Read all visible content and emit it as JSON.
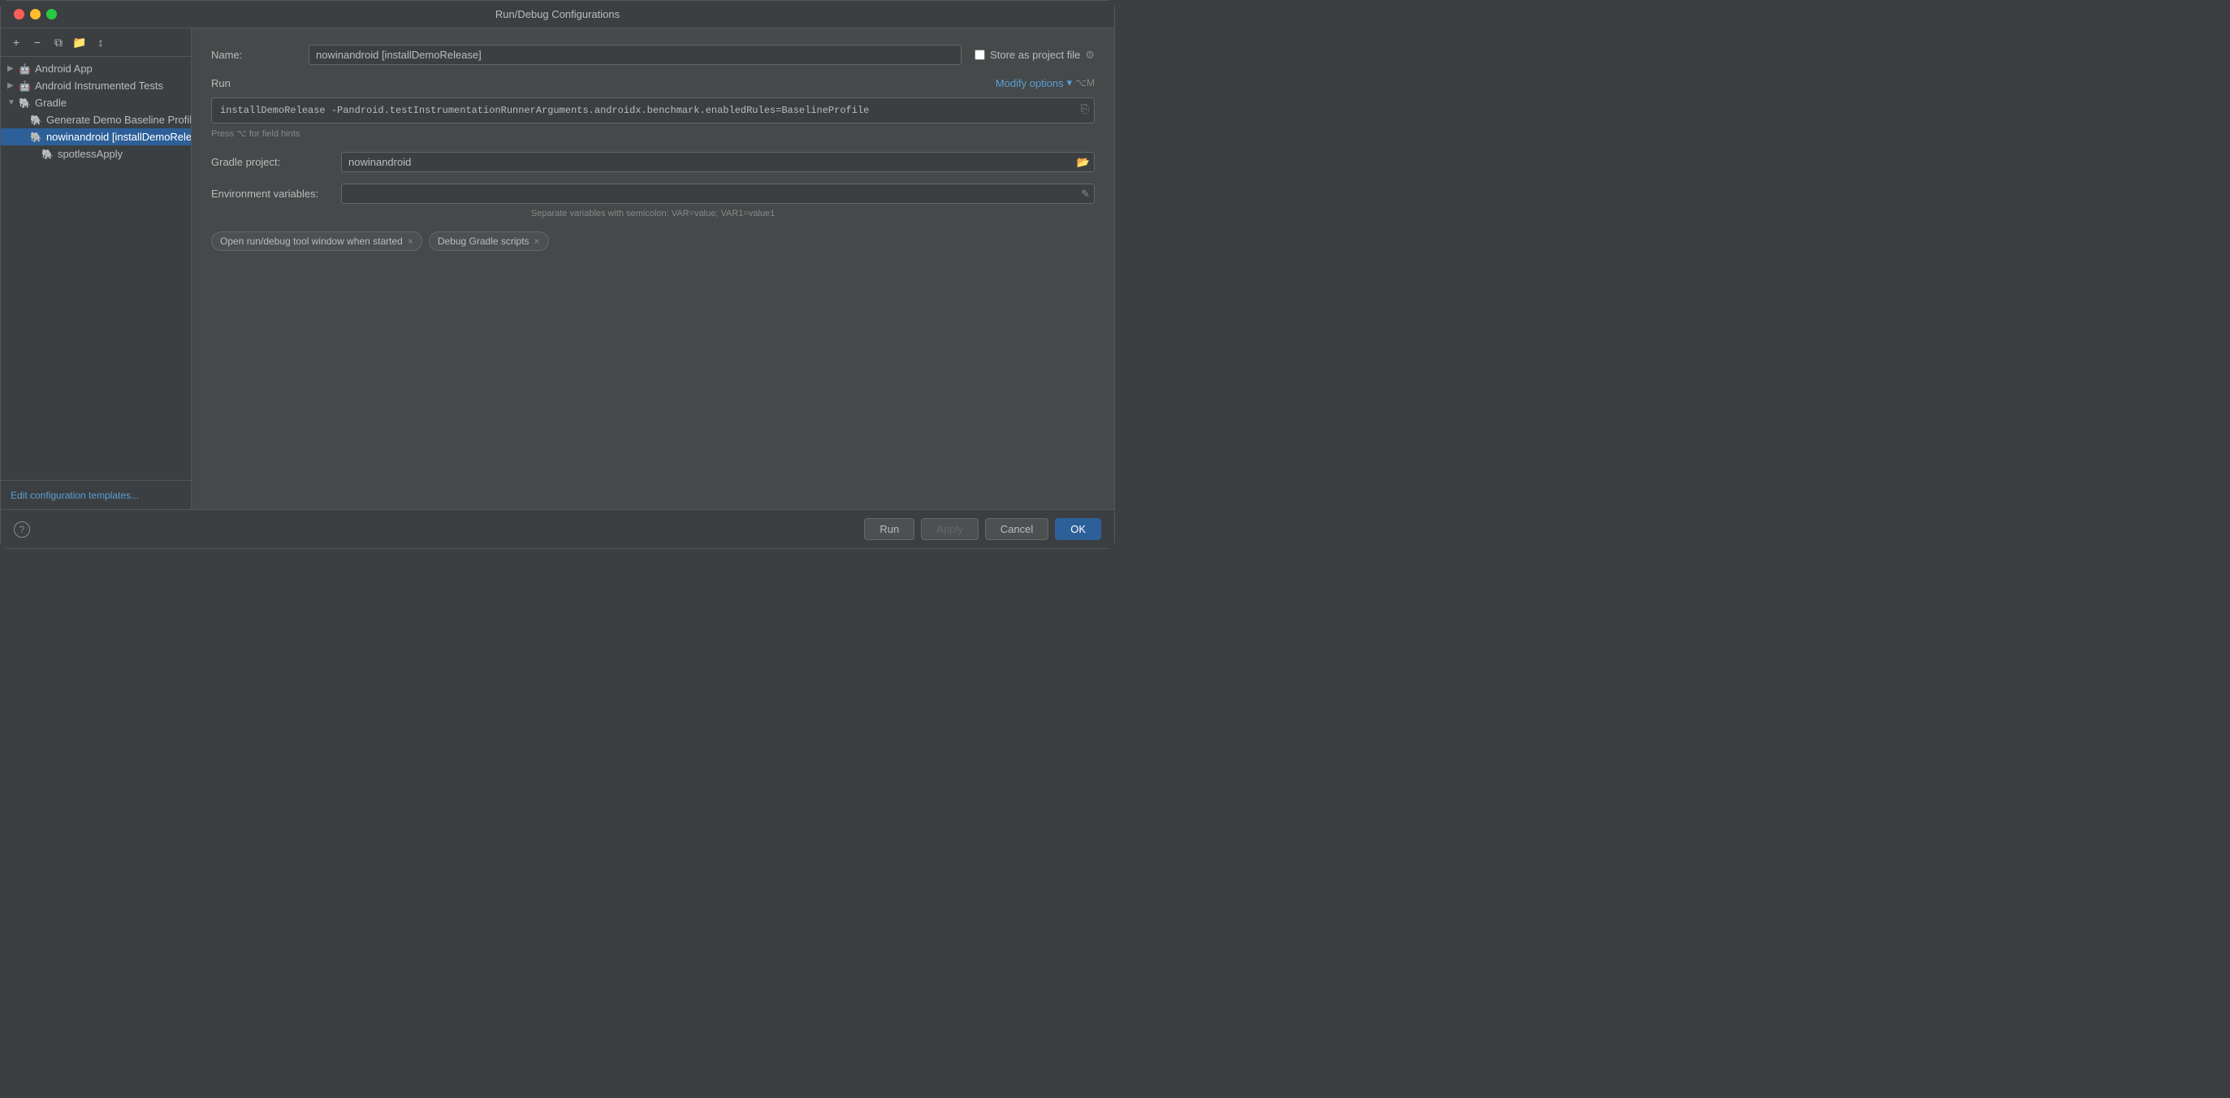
{
  "window": {
    "title": "Run/Debug Configurations"
  },
  "sidebar": {
    "toolbar_buttons": [
      "+",
      "−",
      "⧉",
      "📁",
      "↕"
    ],
    "groups": [
      {
        "name": "Android App",
        "icon": "🤖",
        "arrow": "▶",
        "indent": 0,
        "children": []
      },
      {
        "name": "Android Instrumented Tests",
        "icon": "🤖",
        "arrow": "▶",
        "indent": 0,
        "children": []
      },
      {
        "name": "Gradle",
        "icon": "🐘",
        "arrow": "▼",
        "indent": 0,
        "children": [
          {
            "name": "Generate Demo Baseline Profile",
            "icon": "🐘",
            "indent": 2,
            "selected": false
          },
          {
            "name": "nowinandroid [installDemoRelease]",
            "icon": "🐘",
            "indent": 2,
            "selected": true
          },
          {
            "name": "spotlessApply",
            "icon": "🐘",
            "indent": 2,
            "selected": false
          }
        ]
      }
    ],
    "footer_link": "Edit configuration templates..."
  },
  "content": {
    "name_label": "Name:",
    "name_value": "nowinandroid [installDemoRelease]",
    "store_label": "Store as project file",
    "run_section_title": "Run",
    "modify_options_label": "Modify options",
    "modify_options_shortcut": "⌥M",
    "run_command": "installDemoRelease -Pandroid.testInstrumentationRunnerArguments.androidx.benchmark.enabledRules=BaselineProfile",
    "field_hint": "Press ⌥ for field hints",
    "gradle_project_label": "Gradle project:",
    "gradle_project_value": "nowinandroid",
    "env_vars_label": "Environment variables:",
    "env_vars_value": "",
    "separator_hint": "Separate variables with semicolon: VAR=value; VAR1=value1",
    "tags": [
      {
        "label": "Open run/debug tool window when started",
        "close": "×"
      },
      {
        "label": "Debug Gradle scripts",
        "close": "×"
      }
    ]
  },
  "bottom_bar": {
    "help_label": "?",
    "run_btn": "Run",
    "apply_btn": "Apply",
    "cancel_btn": "Cancel",
    "ok_btn": "OK"
  }
}
